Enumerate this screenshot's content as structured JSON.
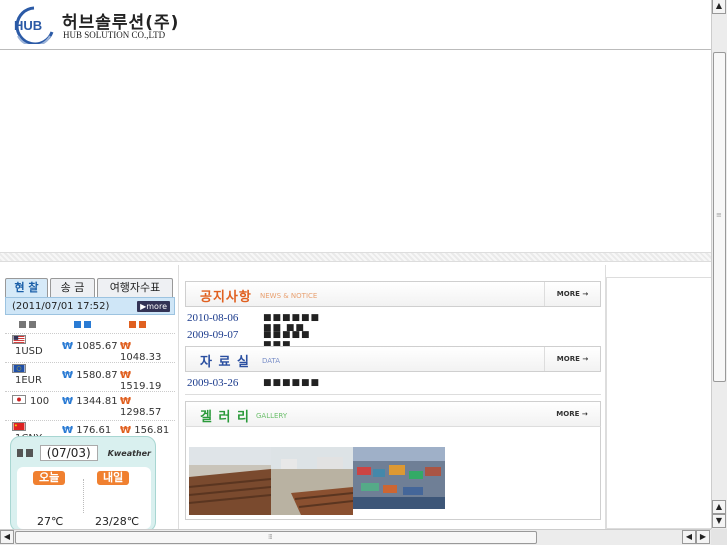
{
  "header": {
    "logo_text": "HUB",
    "company_name": "허브솔루션(주)",
    "company_name_en": "HUB SOLUTION CO.,LTD"
  },
  "exchange": {
    "tabs": [
      {
        "label": "현 찰",
        "active": true
      },
      {
        "label": "송 금",
        "active": false
      },
      {
        "label": "여행자수표",
        "active": false
      }
    ],
    "timestamp": "(2011/07/01 17:52)",
    "more_label": "more",
    "col_colors": [
      "#777777",
      "#2a7bd4",
      "#e06020"
    ],
    "won_symbol": "₩",
    "rows": [
      {
        "currency": "1USD",
        "buy": "1085.67",
        "sell": "1048.33"
      },
      {
        "currency": "1EUR",
        "buy": "1580.87",
        "sell": "1519.19"
      },
      {
        "currency": "100",
        "buy": "1344.81",
        "sell": "1298.57"
      },
      {
        "currency": "1CNY",
        "buy": "176.61",
        "sell": "156.81"
      }
    ]
  },
  "weather": {
    "date": "(07/03)",
    "brand": "Kweather",
    "today_label": "오늘",
    "tomorrow_label": "내일",
    "today_temp": "27℃",
    "tomorrow_temp": "23/28℃"
  },
  "notice": {
    "title": "공지사항",
    "subtitle": "NEWS & NOTICE",
    "more": "MORE",
    "title_color": "#e06020",
    "posts": [
      {
        "date": "2010-08-06",
        "title": "■■■■■■ ■■ ■■"
      },
      {
        "date": "2009-09-07",
        "title": "■■■■■ ■■■ ■■■■ ■■"
      }
    ]
  },
  "data_room": {
    "title": "자 료 실",
    "subtitle": "DATA",
    "more": "MORE",
    "title_color": "#2a4fa0",
    "posts": [
      {
        "date": "2009-03-26",
        "title": "■■■■■■"
      }
    ]
  },
  "gallery": {
    "title": "겔 러 리",
    "subtitle": "GALLERY",
    "more": "MORE",
    "title_color": "#2a9a3a"
  }
}
